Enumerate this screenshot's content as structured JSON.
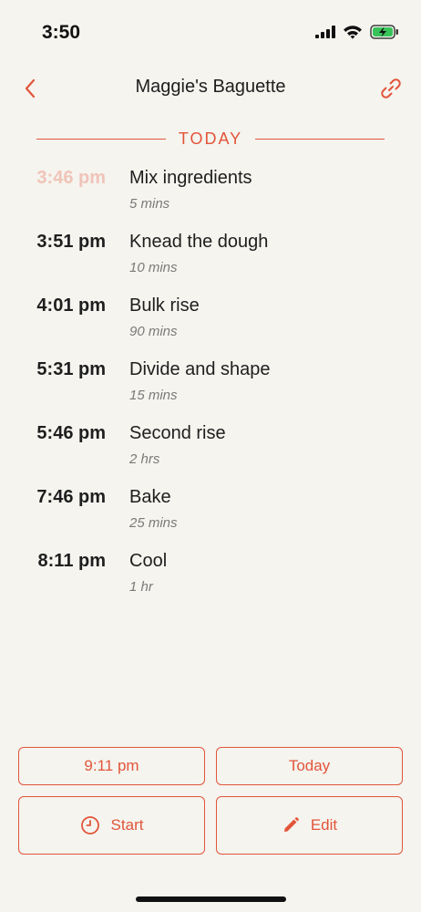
{
  "status_bar": {
    "time": "3:50",
    "icons": [
      "signal-icon",
      "wifi-icon",
      "battery-charging-icon"
    ]
  },
  "nav": {
    "title": "Maggie's Baguette",
    "back_icon": "chevron-left-icon",
    "link_icon": "link-icon"
  },
  "section": {
    "label": "TODAY"
  },
  "steps": [
    {
      "time": "3:46 pm",
      "name": "Mix ingredients",
      "duration": "5 mins",
      "past": true
    },
    {
      "time": "3:51 pm",
      "name": "Knead the dough",
      "duration": "10 mins",
      "past": false
    },
    {
      "time": "4:01 pm",
      "name": "Bulk rise",
      "duration": "90 mins",
      "past": false
    },
    {
      "time": "5:31 pm",
      "name": "Divide and shape",
      "duration": "15 mins",
      "past": false
    },
    {
      "time": "5:46 pm",
      "name": "Second rise",
      "duration": "2 hrs",
      "past": false
    },
    {
      "time": "7:46 pm",
      "name": "Bake",
      "duration": "25 mins",
      "past": false
    },
    {
      "time": "8:11 pm",
      "name": "Cool",
      "duration": "1 hr",
      "past": false
    }
  ],
  "buttons": {
    "end_time": "9:11 pm",
    "day": "Today",
    "start": "Start",
    "edit": "Edit"
  },
  "colors": {
    "accent": "#e2553a",
    "background": "#f5f4ef",
    "past_time": "#f0c4b8",
    "text": "#1e1e1e",
    "muted": "#7a7a7a"
  }
}
